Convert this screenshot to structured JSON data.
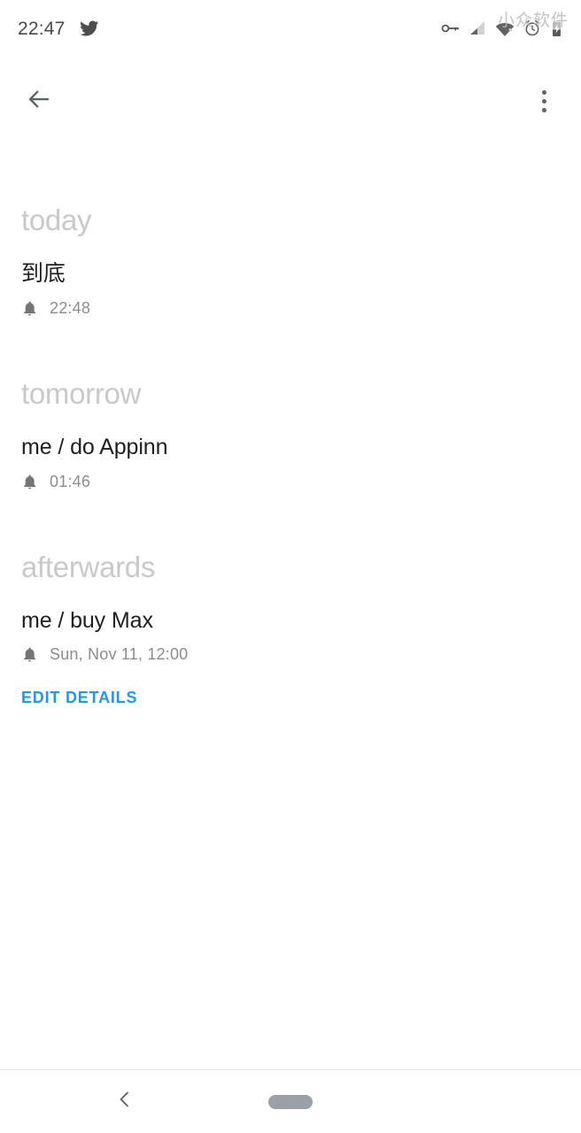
{
  "status_bar": {
    "clock": "22:47",
    "notification_icons": [
      "twitter-icon"
    ],
    "system_icons": [
      "vpn-key-icon",
      "cellular-signal-icon",
      "wifi-off-icon",
      "alarm-clock-icon",
      "battery-icon"
    ]
  },
  "watermark": {
    "text": "小众软件"
  },
  "app_bar": {
    "back_icon": "arrow-back-icon",
    "overflow_icon": "more-vert-icon"
  },
  "sections": [
    {
      "header": "today",
      "tasks": [
        {
          "title": "到底",
          "reminder_icon": "bell-icon",
          "reminder_time": "22:48"
        }
      ]
    },
    {
      "header": "tomorrow",
      "tasks": [
        {
          "title": "me / do Appinn",
          "reminder_icon": "bell-icon",
          "reminder_time": "01:46"
        }
      ]
    },
    {
      "header": "afterwards",
      "tasks": [
        {
          "title": "me / buy Max",
          "reminder_icon": "bell-icon",
          "reminder_time": "Sun, Nov 11, 12:00"
        }
      ]
    }
  ],
  "actions": {
    "edit_details_label": "EDIT DETAILS"
  },
  "nav_bar": {
    "back_icon": "chevron-back-icon",
    "home_icon": "home-pill-icon"
  },
  "colors": {
    "accent_blue": "#2196f3",
    "section_header_gray": "#c9c9c9",
    "task_title_dark": "#1f1f1f",
    "meta_gray": "#8c8c8c",
    "nav_pill_gray": "#9aa0a6"
  }
}
